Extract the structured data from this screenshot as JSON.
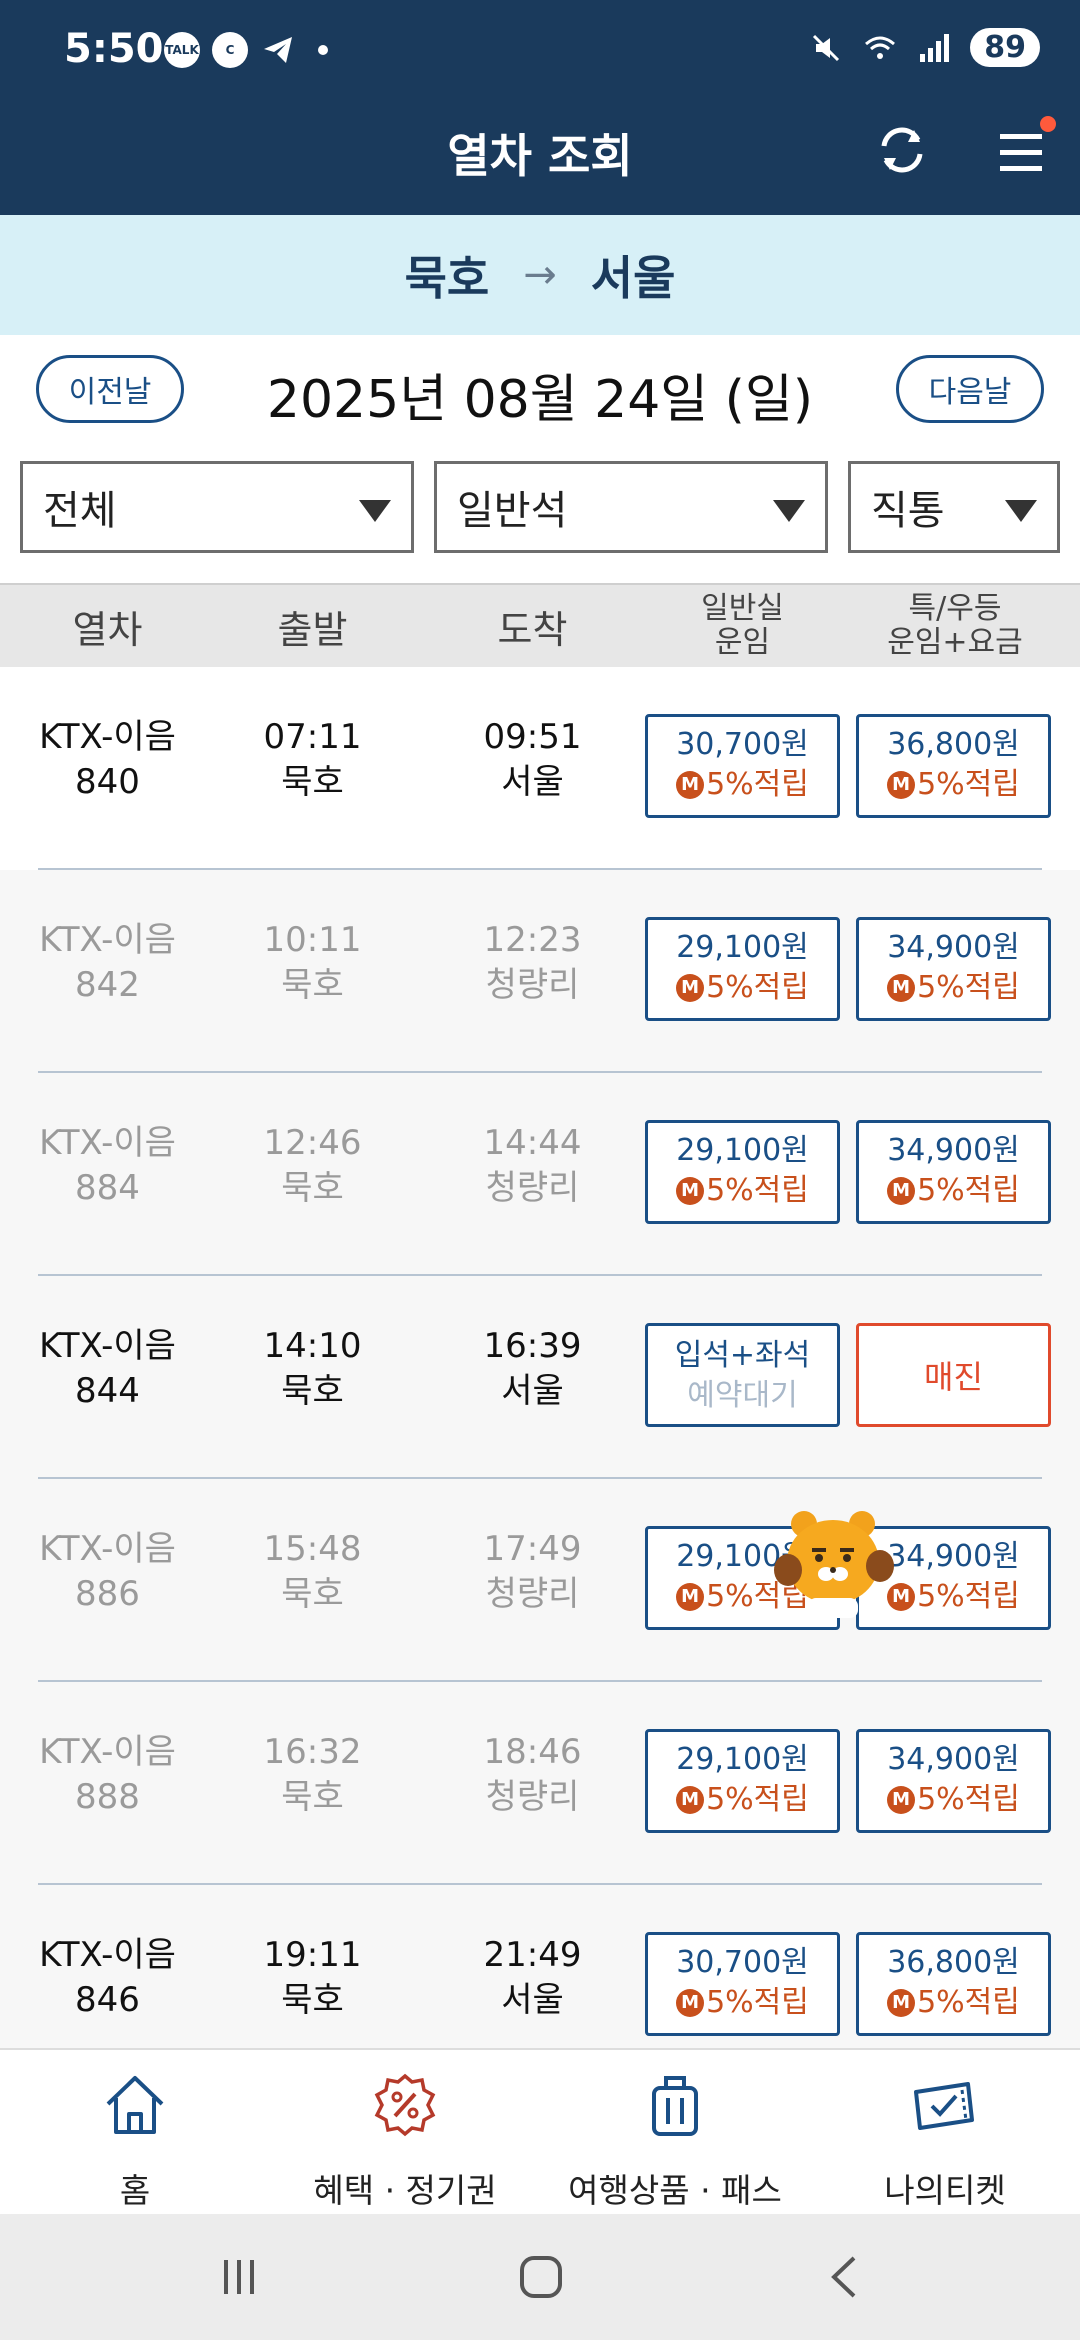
{
  "status": {
    "time": "5:50",
    "battery": "89",
    "notif_talk": "TALK",
    "notif_c": "C"
  },
  "header": {
    "title": "열차 조회"
  },
  "route": {
    "from": "묵호",
    "arrow": "→",
    "to": "서울"
  },
  "date": {
    "prev": "이전날",
    "text": "2025년 08월 24일 (일)",
    "next": "다음날"
  },
  "filters": [
    {
      "value": "전체"
    },
    {
      "value": "일반석"
    },
    {
      "value": "직통"
    }
  ],
  "columns": {
    "train": "열차",
    "depart": "출발",
    "arrive": "도착",
    "standard": "일반실\n운임",
    "special": "특/우등\n운임+요금"
  },
  "rows": [
    {
      "train": "KTX-이음",
      "no": "840",
      "dep_time": "07:11",
      "dep_st": "묵호",
      "arr_time": "09:51",
      "arr_st": "서울",
      "std_price": "30,700원",
      "spc_price": "36,800원",
      "points": "5%적립"
    },
    {
      "train": "KTX-이음",
      "no": "842",
      "dep_time": "10:11",
      "dep_st": "묵호",
      "arr_time": "12:23",
      "arr_st": "청량리",
      "std_price": "29,100원",
      "spc_price": "34,900원",
      "points": "5%적립"
    },
    {
      "train": "KTX-이음",
      "no": "884",
      "dep_time": "12:46",
      "dep_st": "묵호",
      "arr_time": "14:44",
      "arr_st": "청량리",
      "std_price": "29,100원",
      "spc_price": "34,900원",
      "points": "5%적립"
    },
    {
      "train": "KTX-이음",
      "no": "844",
      "dep_time": "14:10",
      "dep_st": "묵호",
      "arr_time": "16:39",
      "arr_st": "서울",
      "wait_line1": "입석+좌석",
      "wait_line2": "예약대기",
      "soldout": "매진"
    },
    {
      "train": "KTX-이음",
      "no": "886",
      "dep_time": "15:48",
      "dep_st": "묵호",
      "arr_time": "17:49",
      "arr_st": "청량리",
      "std_price": "29,100원",
      "spc_price": "34,900원",
      "points": "5%적립"
    },
    {
      "train": "KTX-이음",
      "no": "888",
      "dep_time": "16:32",
      "dep_st": "묵호",
      "arr_time": "18:46",
      "arr_st": "청량리",
      "std_price": "29,100원",
      "spc_price": "34,900원",
      "points": "5%적립"
    },
    {
      "train": "KTX-이음",
      "no": "846",
      "dep_time": "19:11",
      "dep_st": "묵호",
      "arr_time": "21:49",
      "arr_st": "서울",
      "std_price": "30,700원",
      "spc_price": "36,800원",
      "points": "5%적립"
    }
  ],
  "points_badge": "M",
  "nav": [
    {
      "label": "홈",
      "icon": "home-icon"
    },
    {
      "label": "혜택 · 정기권",
      "icon": "discount-icon"
    },
    {
      "label": "여행상품 · 패스",
      "icon": "luggage-icon"
    },
    {
      "label": "나의티켓",
      "icon": "ticket-icon"
    }
  ],
  "colors": {
    "header": "#1a3a5c",
    "route_bg": "#d7f0f7",
    "accent": "#1a4f86",
    "points": "#c8501c",
    "soldout": "#e04a2c"
  }
}
